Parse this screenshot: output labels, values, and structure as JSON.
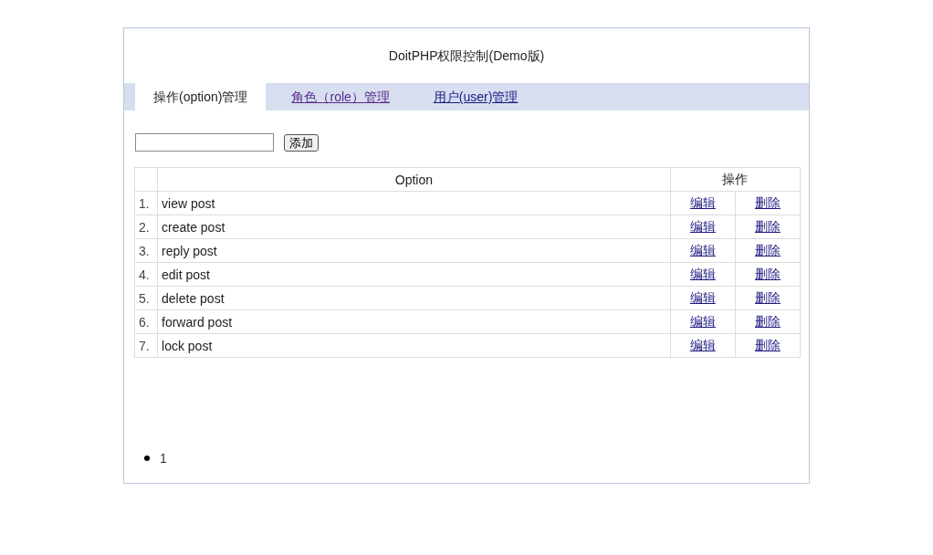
{
  "title": "DoitPHP权限控制(Demo版)",
  "tabs": [
    {
      "label": "操作(option)管理",
      "selected": true,
      "visited": false
    },
    {
      "label": "角色（role）管理",
      "selected": false,
      "visited": true
    },
    {
      "label": "用户(user)管理",
      "selected": false,
      "visited": false
    }
  ],
  "add_form": {
    "button": "添加"
  },
  "table": {
    "columns": [
      "Option",
      "操作"
    ],
    "rows": [
      {
        "index": "1.",
        "option": "view post",
        "edit": "编辑",
        "delete": "删除"
      },
      {
        "index": "2.",
        "option": "create post",
        "edit": "编辑",
        "delete": "删除"
      },
      {
        "index": "3.",
        "option": "reply post",
        "edit": "编辑",
        "delete": "删除"
      },
      {
        "index": "4.",
        "option": "edit post",
        "edit": "编辑",
        "delete": "删除"
      },
      {
        "index": "5.",
        "option": "delete post",
        "edit": "编辑",
        "delete": "删除"
      },
      {
        "index": "6.",
        "option": "forward post",
        "edit": "编辑",
        "delete": "删除"
      },
      {
        "index": "7.",
        "option": "lock post",
        "edit": "编辑",
        "delete": "删除"
      }
    ]
  },
  "pagination": [
    "1"
  ]
}
